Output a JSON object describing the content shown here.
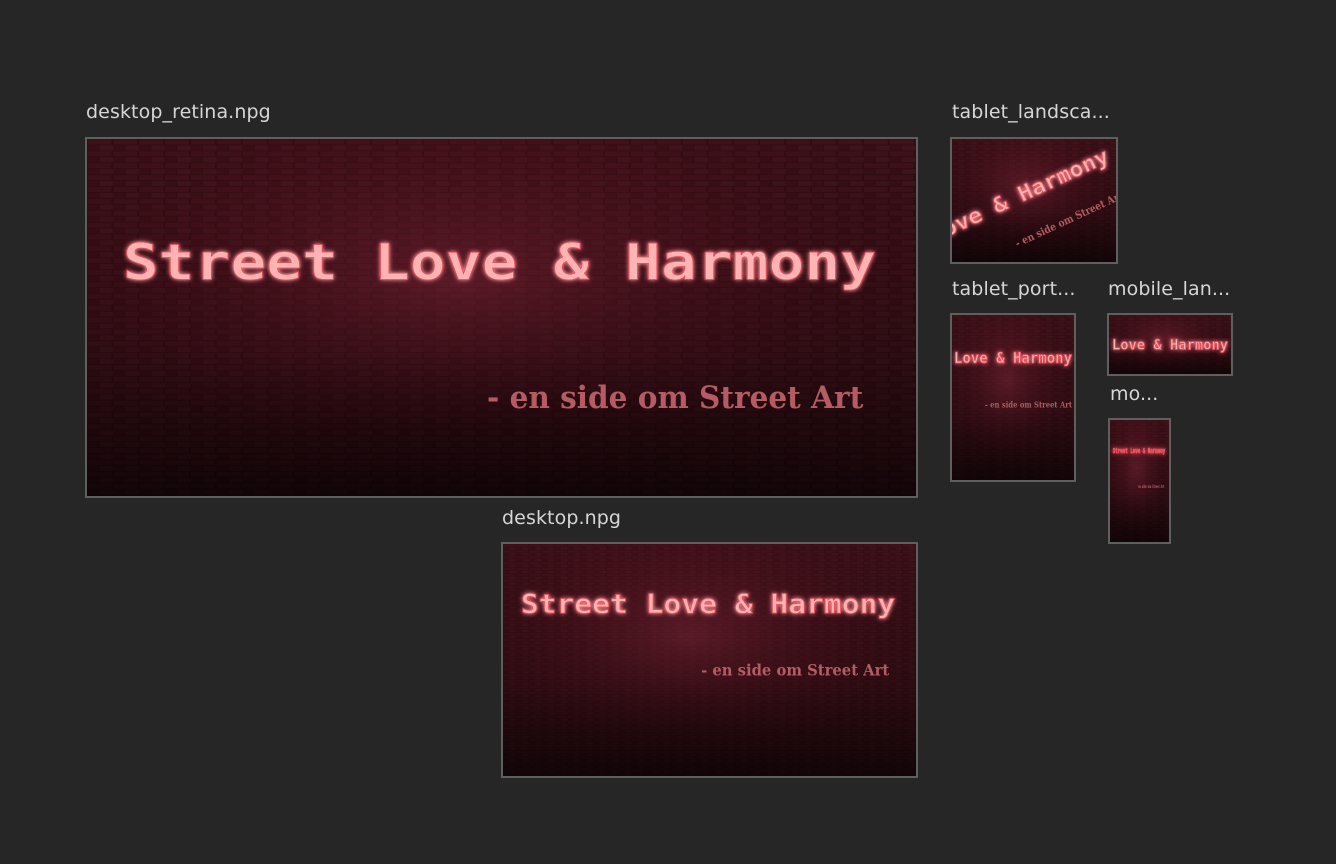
{
  "artboards": [
    {
      "label": "desktop_retina.npg",
      "title": "Street Love & Harmony",
      "subtitle": "- en side om Street Art"
    },
    {
      "label": "desktop.npg",
      "title": "Street Love & Harmony",
      "subtitle": "- en side om Street Art"
    },
    {
      "label": "tablet_landsca...",
      "title": "Love & Harmony",
      "subtitle": "- en side om Street Art"
    },
    {
      "label": "tablet_port...",
      "title": "Love & Harmony",
      "subtitle": "- en side om Street Art"
    },
    {
      "label": "mobile_lan...",
      "title": "Love & Harmony",
      "subtitle": ""
    },
    {
      "label": "mo...",
      "title": "Street Love & Harmony",
      "subtitle": "en side om Street Art"
    }
  ],
  "colors": {
    "canvas": "#262626",
    "label": "#d6d6d6",
    "artboard_border": "#5f5f5f",
    "brick_dark": "#1a080b",
    "brick_red": "#5a1620",
    "neon_fill": "#ffb3b3",
    "neon_glow": "#e84a56",
    "subtitle": "#b45b63"
  }
}
